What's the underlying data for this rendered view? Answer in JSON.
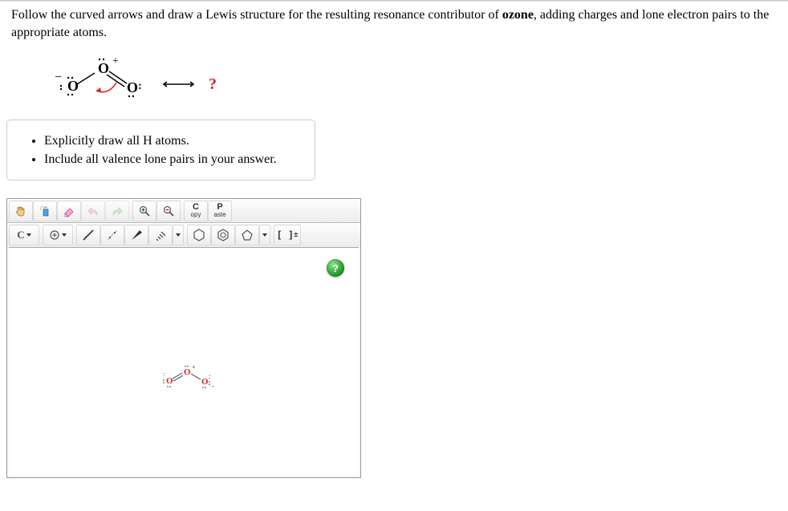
{
  "topbar": {},
  "question": {
    "lead": "Follow the curved arrows and draw a Lewis structure for the resulting resonance contributor of ",
    "bold": "ozone",
    "tail": ", adding charges and lone electron pairs to the appropriate atoms."
  },
  "resonance_indicator": "?",
  "hints": {
    "items": [
      "Explicitly draw all H atoms.",
      "Include all valence lone pairs in your answer."
    ]
  },
  "toolbar": {
    "copy": {
      "big": "C",
      "small": "opy"
    },
    "paste": {
      "big": "P",
      "small": "aste"
    },
    "carbon": "C",
    "bracket_left": "[",
    "bracket_right": "]",
    "charge_sign": "±"
  },
  "help": "?",
  "colors": {
    "red": "#d92020",
    "green": "#2e9e2e"
  },
  "structure_atoms": [
    "O",
    "O",
    "O"
  ]
}
